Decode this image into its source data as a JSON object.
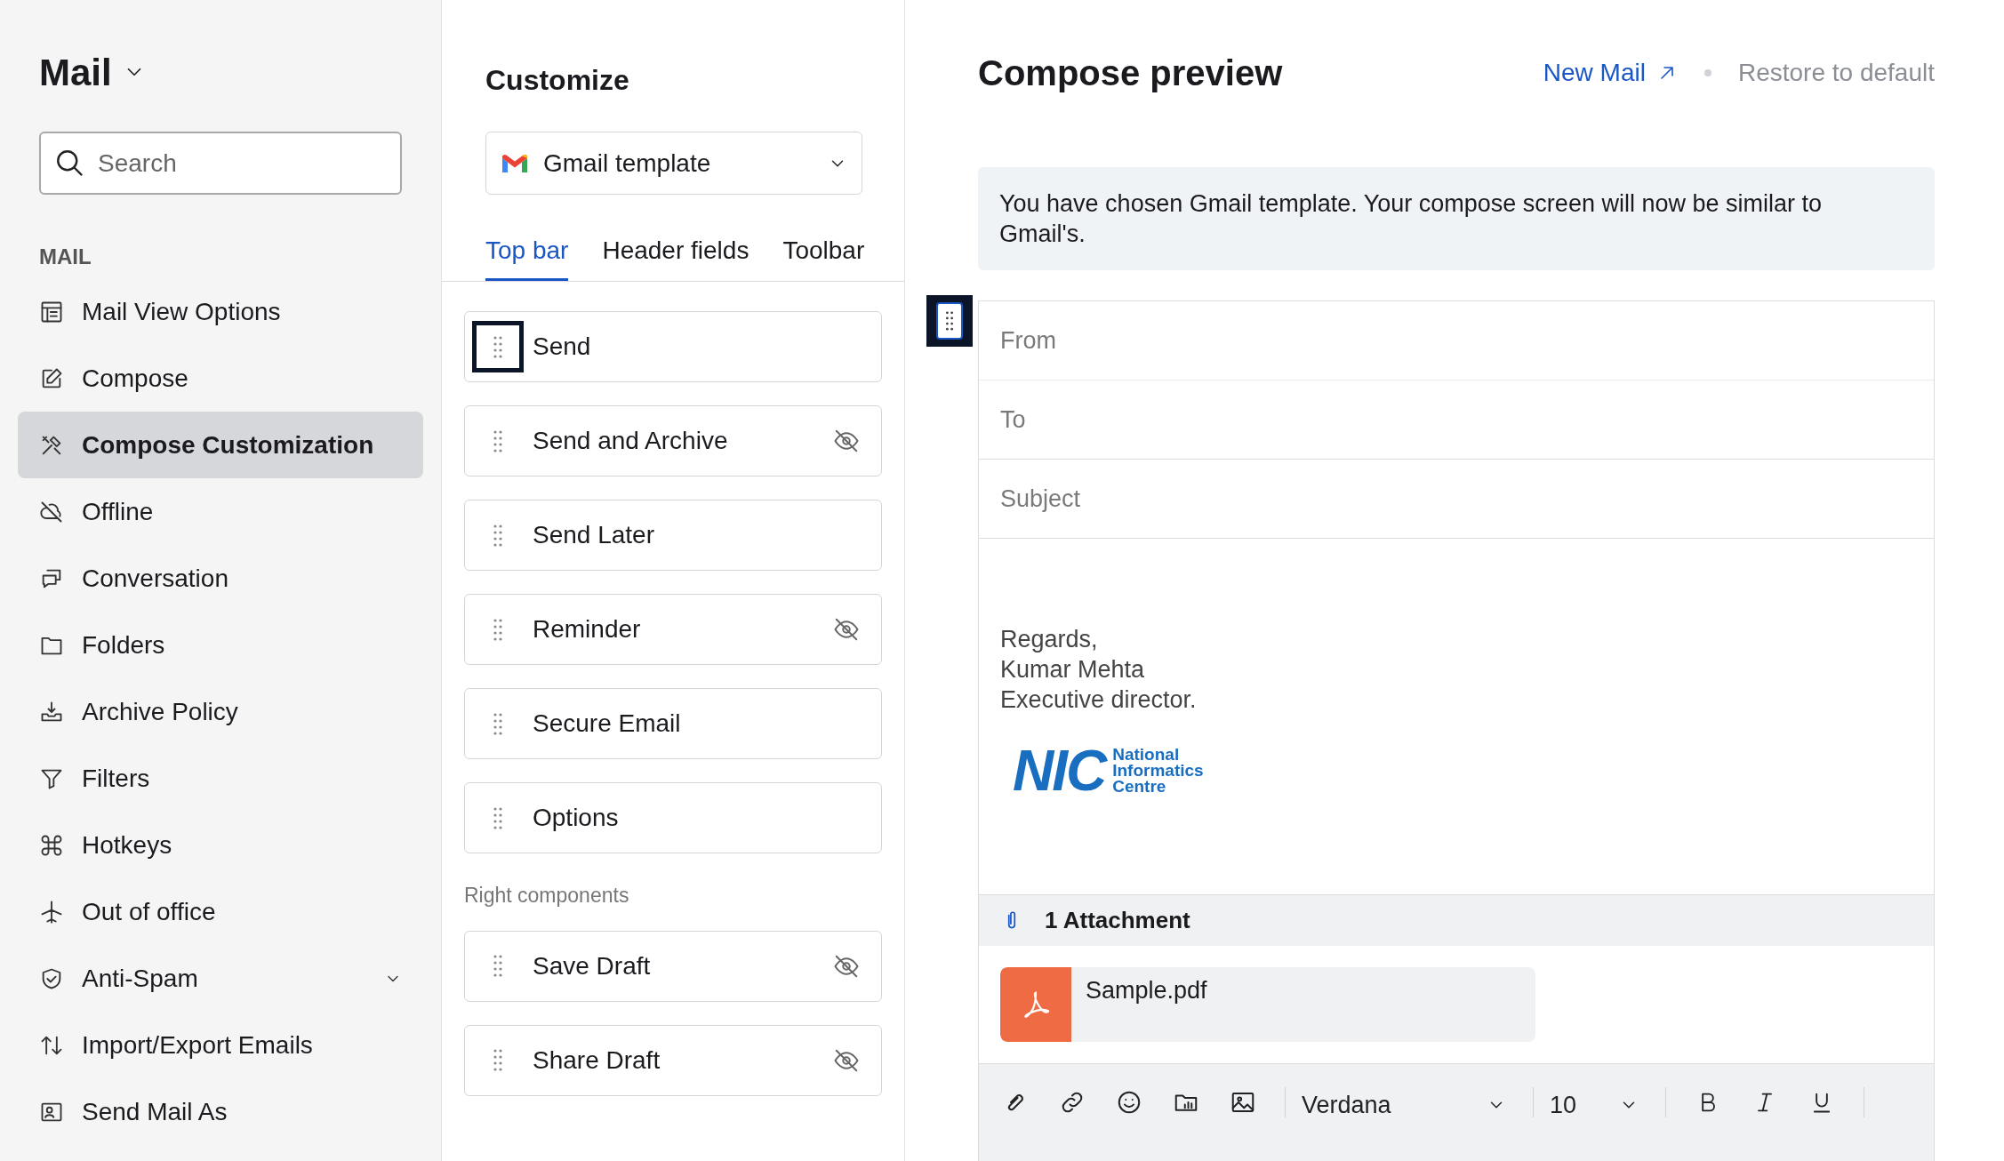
{
  "sidebar": {
    "title": "Mail",
    "search": {
      "placeholder": "Search"
    },
    "section": "MAIL",
    "items": [
      {
        "label": "Mail View Options",
        "selected": false
      },
      {
        "label": "Compose",
        "selected": false
      },
      {
        "label": "Compose Customization",
        "selected": true
      },
      {
        "label": "Offline",
        "selected": false
      },
      {
        "label": "Conversation",
        "selected": false
      },
      {
        "label": "Folders",
        "selected": false
      },
      {
        "label": "Archive Policy",
        "selected": false
      },
      {
        "label": "Filters",
        "selected": false
      },
      {
        "label": "Hotkeys",
        "selected": false
      },
      {
        "label": "Out of office",
        "selected": false
      },
      {
        "label": "Anti-Spam",
        "selected": false,
        "expandable": true
      },
      {
        "label": "Import/Export Emails",
        "selected": false
      },
      {
        "label": "Send Mail As",
        "selected": false
      }
    ]
  },
  "customize": {
    "title": "Customize",
    "template": "Gmail template",
    "tabs": [
      {
        "label": "Top bar",
        "selected": true
      },
      {
        "label": "Header fields",
        "selected": false
      },
      {
        "label": "Toolbar",
        "selected": false
      }
    ],
    "components": [
      {
        "label": "Send",
        "hidden": false,
        "focused": true
      },
      {
        "label": "Send and Archive",
        "hidden": true,
        "focused": false
      },
      {
        "label": "Send Later",
        "hidden": false,
        "focused": false
      },
      {
        "label": "Reminder",
        "hidden": true,
        "focused": false
      },
      {
        "label": "Secure Email",
        "hidden": false,
        "focused": false
      },
      {
        "label": "Options",
        "hidden": false,
        "focused": false
      }
    ],
    "right_label": "Right components",
    "right_components": [
      {
        "label": "Save Draft",
        "hidden": true,
        "focused": false
      },
      {
        "label": "Share Draft",
        "hidden": true,
        "focused": false
      }
    ]
  },
  "preview": {
    "title": "Compose preview",
    "actions": [
      {
        "label": "New Mail",
        "kind": "link"
      },
      {
        "label": "Restore to default",
        "kind": "muted"
      }
    ],
    "notice": "You have chosen Gmail template. Your compose screen will now be similar to Gmail's.",
    "fields": [
      {
        "placeholder": "From"
      },
      {
        "placeholder": "To"
      },
      {
        "placeholder": "Subject"
      }
    ],
    "signature": {
      "lines": [
        "Regards,",
        "Kumar Mehta",
        "Executive director."
      ],
      "logo": {
        "mark": "NIC",
        "name_lines": [
          "National",
          "Informatics",
          "Centre"
        ]
      }
    },
    "attachments": {
      "count_label": "1 Attachment",
      "files": [
        {
          "name": "Sample.pdf"
        }
      ]
    },
    "toolbar": {
      "font": "Verdana",
      "size": "10"
    }
  }
}
